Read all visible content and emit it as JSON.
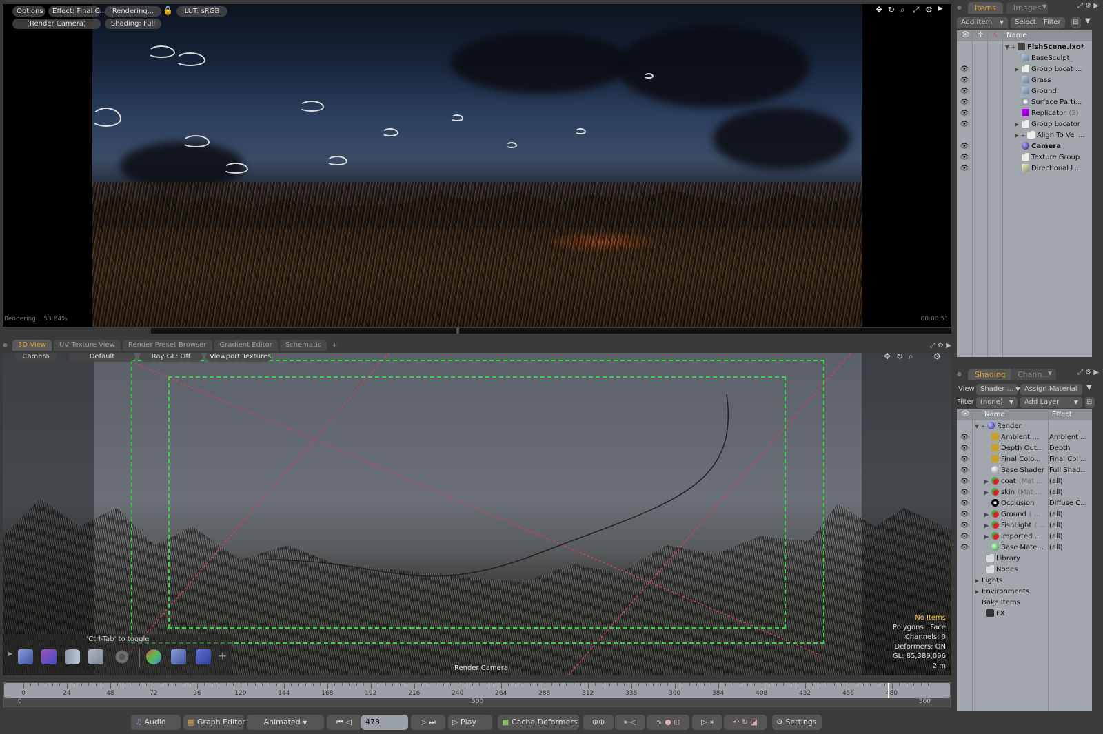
{
  "render_view": {
    "buttons": {
      "options": "Options",
      "effect": "Effect: Final C...",
      "rendering": "Rendering...",
      "lut": "LUT: sRGB",
      "camera": "(Render Camera)",
      "shading": "Shading: Full"
    },
    "icons": [
      "move-icon",
      "rotate-icon",
      "zoom-icon",
      "maximize-icon",
      "gear-icon",
      "play-arrow-icon"
    ],
    "status": "Rendering... 53.84%",
    "elapsed": "00:00:51",
    "progress_percent": 53.84
  },
  "viewport_tabs": {
    "tabs": [
      "3D View",
      "UV Texture View",
      "Render Preset Browser",
      "Gradient Editor",
      "Schematic"
    ],
    "active": "3D View",
    "add": "+"
  },
  "view3d": {
    "buttons": {
      "camera": "Camera",
      "default": "Default",
      "raygl": "Ray GL: Off",
      "textures": "Viewport Textures"
    },
    "info": {
      "items": "No Items",
      "polygons": "Polygons : Face",
      "channels": "Channels: 0",
      "deformers": "Deformers: ON",
      "gl": "GL: 85,389,096",
      "scale": "2 m"
    },
    "camera_label": "Render Camera",
    "toolbox_hint": "'Ctrl-Tab' to toggle"
  },
  "timeline": {
    "ticks": [
      "0",
      "24",
      "48",
      "72",
      "96",
      "120",
      "144",
      "168",
      "192",
      "216",
      "240",
      "264",
      "288",
      "312",
      "336",
      "360",
      "384",
      "408",
      "432",
      "456",
      "480"
    ],
    "current_frame_label": "478",
    "range_start": "0",
    "range_mid": "500",
    "range_end": "500"
  },
  "transport": {
    "audio": "Audio",
    "graph_editor": "Graph Editor",
    "mode": "Animated",
    "frame": "478",
    "play": "Play",
    "cache": "Cache Deformers",
    "settings": "Settings"
  },
  "items_panel": {
    "tabs": [
      "Items",
      "Images"
    ],
    "add_item": "Add Item",
    "select": "Select",
    "filter": "Filter",
    "column_name": "Name",
    "rows": [
      {
        "name": "FishScene.lxo*",
        "bold": true,
        "eye": false,
        "indent": 0,
        "expand": "▼ +",
        "icon": "scene"
      },
      {
        "name": "BaseSculpt_",
        "eye": false,
        "indent": 1,
        "expand": "",
        "icon": "mesh"
      },
      {
        "name": "Group Locat ...",
        "eye": true,
        "indent": 1,
        "expand": "▶",
        "icon": "group"
      },
      {
        "name": "Grass",
        "eye": true,
        "indent": 1,
        "expand": "",
        "icon": "mesh"
      },
      {
        "name": "Ground",
        "eye": true,
        "indent": 1,
        "expand": "",
        "icon": "mesh"
      },
      {
        "name": "Surface Parti...",
        "eye": true,
        "indent": 1,
        "expand": "",
        "icon": "particles"
      },
      {
        "name": "Replicator",
        "suffix": "(2)",
        "eye": true,
        "indent": 1,
        "expand": "",
        "icon": "replicator"
      },
      {
        "name": "Group Locator",
        "eye": true,
        "indent": 1,
        "expand": "▶",
        "icon": "group"
      },
      {
        "name": "Align To Vel ...",
        "eye": false,
        "indent": 1,
        "expand": "▶ +",
        "icon": "group"
      },
      {
        "name": "Camera",
        "bold": true,
        "eye": true,
        "indent": 1,
        "expand": "",
        "icon": "camera"
      },
      {
        "name": "Texture Group",
        "eye": true,
        "indent": 1,
        "expand": "",
        "icon": "group"
      },
      {
        "name": "Directional L...",
        "eye": true,
        "indent": 1,
        "expand": "",
        "icon": "light"
      }
    ]
  },
  "shading_panel": {
    "tabs": [
      "Shading",
      "Chann..."
    ],
    "view_label": "View",
    "view_value": "Shader ...",
    "assign_material": "Assign Material",
    "filter_label": "Filter",
    "filter_value": "(none)",
    "add_layer": "Add Layer",
    "col_name": "Name",
    "col_effect": "Effect",
    "rows": [
      {
        "name": "Render",
        "effect": "",
        "eye": false,
        "indent": 0,
        "expand": "▼ +",
        "icon": "render"
      },
      {
        "name": "Ambient ...",
        "effect": "Ambient ...",
        "eye": true,
        "indent": 1,
        "expand": "",
        "icon": "output"
      },
      {
        "name": "Depth Out...",
        "effect": "Depth",
        "eye": true,
        "indent": 1,
        "expand": "",
        "icon": "output"
      },
      {
        "name": "Final Colo...",
        "effect": "Final Col ...",
        "eye": true,
        "indent": 1,
        "expand": "",
        "icon": "output"
      },
      {
        "name": "Base Shader",
        "effect": "Full Shad...",
        "eye": true,
        "indent": 1,
        "expand": "",
        "icon": "shader"
      },
      {
        "name": "coat",
        "suffix": "(Mat ...",
        "effect": "(all)",
        "eye": true,
        "indent": 1,
        "expand": "▶",
        "icon": "material"
      },
      {
        "name": "skin",
        "suffix": "(Mat ...",
        "effect": "(all)",
        "eye": true,
        "indent": 1,
        "expand": "▶",
        "icon": "material"
      },
      {
        "name": "Occlusion",
        "effect": "Diffuse C...",
        "eye": true,
        "indent": 1,
        "expand": "",
        "icon": "occlusion"
      },
      {
        "name": "Ground",
        "suffix": "( ...",
        "effect": "(all)",
        "eye": true,
        "indent": 1,
        "expand": "▶",
        "icon": "material"
      },
      {
        "name": "FishLight",
        "suffix": "( ...",
        "effect": "(all)",
        "eye": true,
        "indent": 1,
        "expand": "▶",
        "icon": "material"
      },
      {
        "name": "imported ...",
        "effect": "(all)",
        "eye": true,
        "indent": 1,
        "expand": "▶",
        "icon": "material"
      },
      {
        "name": "Base Mate...",
        "effect": "(all)",
        "eye": true,
        "indent": 1,
        "expand": "",
        "icon": "basematerial"
      },
      {
        "name": "Library",
        "effect": "",
        "eye": false,
        "indent": 0.5,
        "expand": "",
        "icon": "folder"
      },
      {
        "name": "Nodes",
        "effect": "",
        "eye": false,
        "indent": 0.5,
        "expand": "",
        "icon": "folder"
      },
      {
        "name": "Lights",
        "effect": "",
        "eye": false,
        "indent": 0,
        "expand": "▶",
        "icon": ""
      },
      {
        "name": "Environments",
        "effect": "",
        "eye": false,
        "indent": 0,
        "expand": "▶",
        "icon": ""
      },
      {
        "name": "Bake Items",
        "effect": "",
        "eye": false,
        "indent": 0,
        "expand": "",
        "icon": ""
      },
      {
        "name": "FX",
        "effect": "",
        "eye": false,
        "indent": 0.5,
        "expand": "",
        "icon": "fx"
      }
    ]
  },
  "colors": {
    "accent": "#e0a030",
    "safe_frame": "#3ad04a",
    "warning": "#f0c040"
  }
}
